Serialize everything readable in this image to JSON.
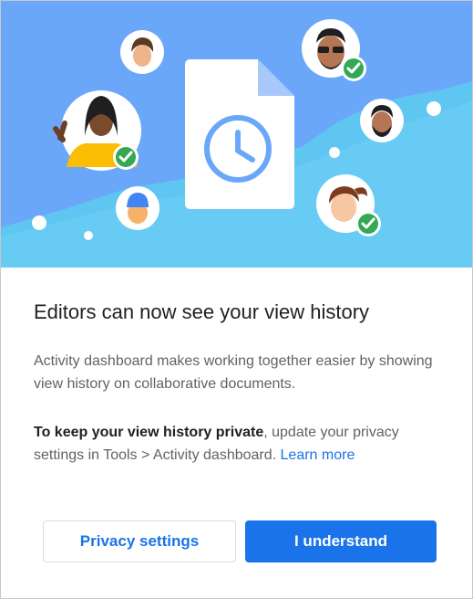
{
  "dialog": {
    "title": "Editors can now see your view history",
    "paragraph_1": "Activity dashboard makes working together easier by showing view history on collaborative documents.",
    "paragraph_2_bold": "To keep your view history private",
    "paragraph_2_text": ", update your privacy settings in Tools > Activity dashboard. ",
    "learn_more": "Learn more",
    "secondary_button": "Privacy settings",
    "primary_button": "I understand"
  },
  "illustration": {
    "icons": [
      "document-icon",
      "clock-icon",
      "avatar-icons",
      "checkmark-badge-icons"
    ],
    "colors": {
      "sky": "#6aa7f8",
      "wave": "#5ec6f1",
      "accent_blue": "#1a73e8",
      "check_green": "#34a853"
    }
  }
}
